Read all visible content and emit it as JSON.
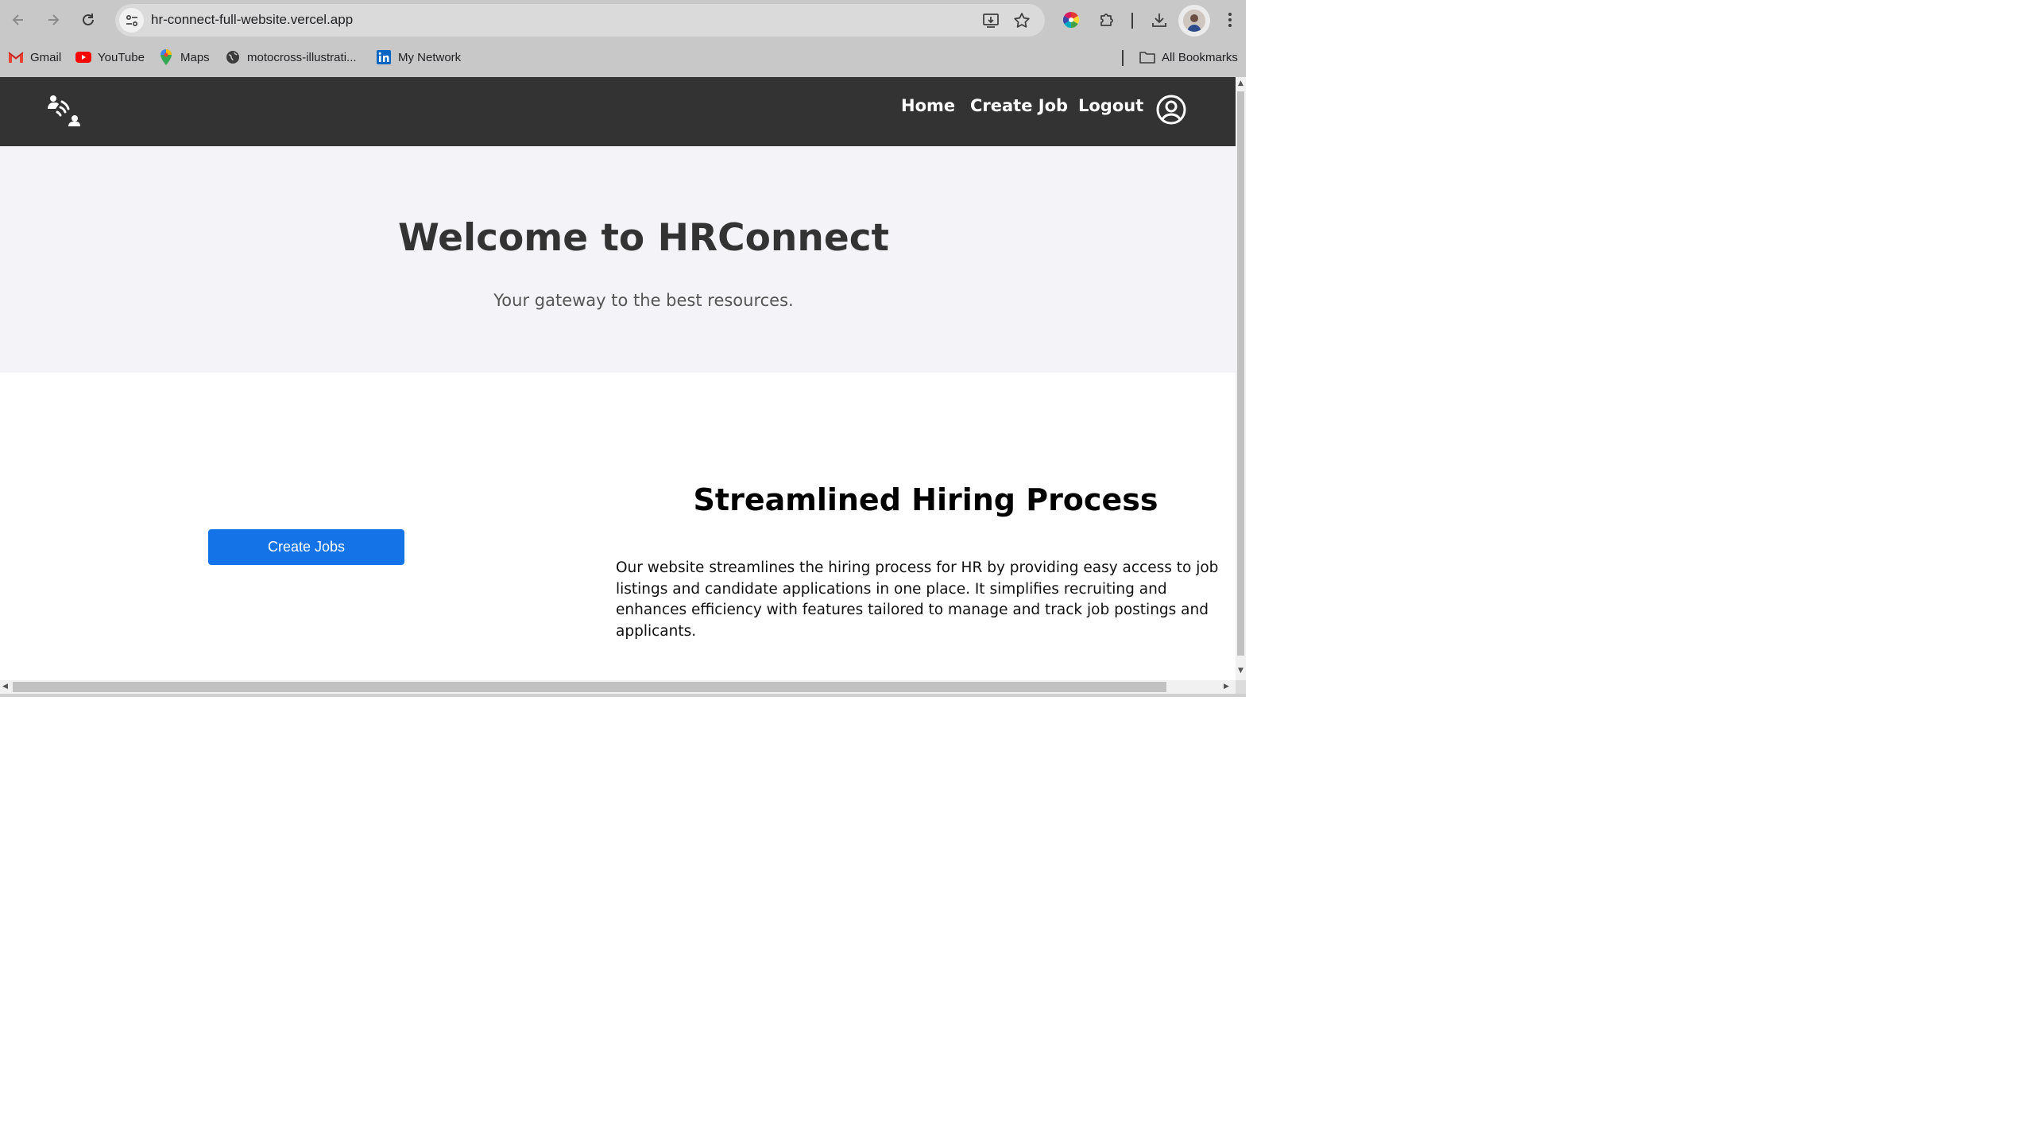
{
  "browser": {
    "url": "hr-connect-full-website.vercel.app",
    "bookmarks": [
      {
        "label": "Gmail",
        "icon": "gmail-icon"
      },
      {
        "label": "YouTube",
        "icon": "youtube-icon"
      },
      {
        "label": "Maps",
        "icon": "maps-icon"
      },
      {
        "label": "motocross-illustrati...",
        "icon": "globe-icon"
      },
      {
        "label": "My Network",
        "icon": "linkedin-icon"
      }
    ],
    "all_bookmarks_label": "All Bookmarks"
  },
  "header": {
    "nav": {
      "home": "Home",
      "create_job": "Create Job",
      "logout": "Logout"
    },
    "logo_icon": "hr-connect-logo-icon",
    "profile_icon": "user-circle-icon"
  },
  "hero": {
    "title": "Welcome to HRConnect",
    "subtitle": "Your gateway to the best resources."
  },
  "feature": {
    "button_label": "Create Jobs",
    "title": "Streamlined Hiring Process",
    "description": "Our website streamlines the hiring process for HR by providing easy access to job listings and candidate applications in one place. It simplifies recruiting and enhances efficiency with features tailored to manage and track job postings and applicants."
  },
  "colors": {
    "header_bg": "#333333",
    "hero_bg": "#f4f4f8",
    "primary_button": "#1473e6"
  }
}
